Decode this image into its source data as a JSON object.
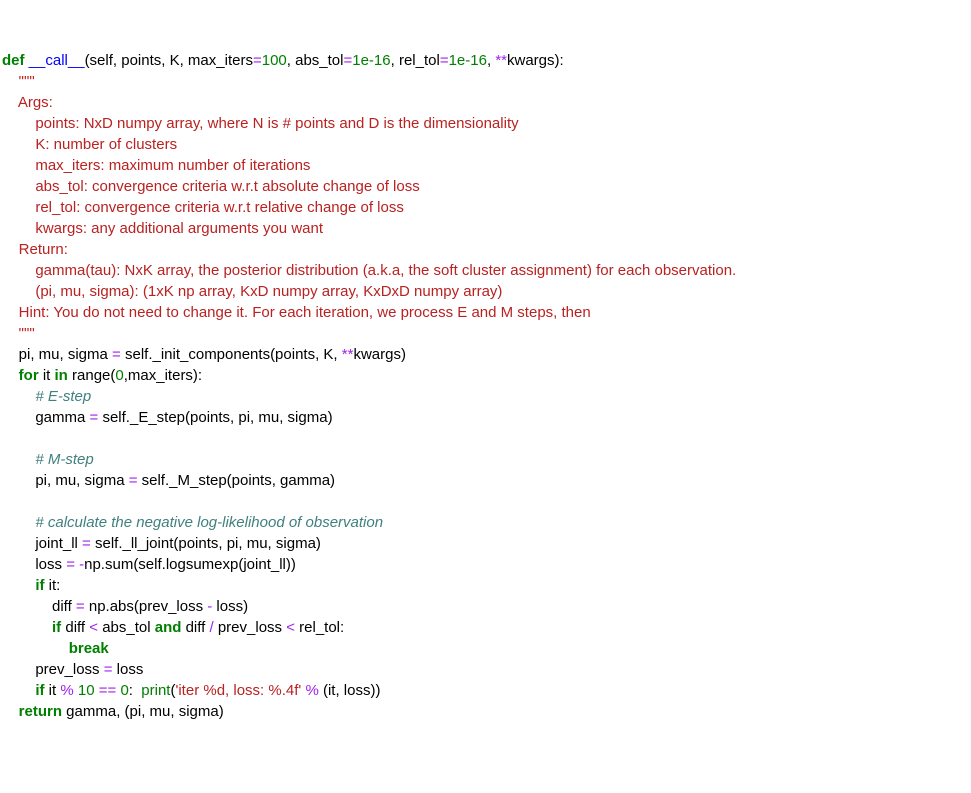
{
  "sig": {
    "def": "def",
    "name": "__call__",
    "open": "(self, points, K, max_iters",
    "eq1": "=",
    "v1": "100",
    "s1": ", abs_tol",
    "eq2": "=",
    "v2": "1e-16",
    "s2": ", rel_tol",
    "eq3": "=",
    "v3": "1e-16",
    "s3": ", ",
    "star": "**",
    "s4": "kwargs):"
  },
  "doc": {
    "q1": "    \"\"\"",
    "args": "    Args:",
    "a1": "        points: NxD numpy array, where N is # points and D is the dimensionality",
    "a2": "        K: number of clusters",
    "a3": "        max_iters: maximum number of iterations",
    "a4": "        abs_tol: convergence criteria w.r.t absolute change of loss",
    "a5": "        rel_tol: convergence criteria w.r.t relative change of loss",
    "a6": "        kwargs: any additional arguments you want",
    "ret": "    Return:",
    "r1": "        gamma(tau): NxK array, the posterior distribution (a.k.a, the soft cluster assignment) for each observation.",
    "r2": "        (pi, mu, sigma): (1xK np array, KxD numpy array, KxDxD numpy array)",
    "hint": "    Hint: You do not need to change it. For each iteration, we process E and M steps, then ",
    "q2": "    \"\"\""
  },
  "l1": {
    "pre": "    pi, mu, sigma ",
    "eq": "=",
    "mid": " self._init_components(points, K, ",
    "star": "**",
    "rest": "kwargs)"
  },
  "l2": {
    "pad": "    ",
    "for": "for",
    "mid1": " it ",
    "in": "in",
    "sp": " ",
    "range": "range",
    "open": "(",
    "zero": "0",
    "rest": ",max_iters):"
  },
  "c1": "        # E-step",
  "l3": {
    "pre": "        gamma ",
    "eq": "=",
    "rest": " self._E_step(points, pi, mu, sigma)"
  },
  "c2": "        # M-step",
  "l4": {
    "pre": "        pi, mu, sigma ",
    "eq": "=",
    "rest": " self._M_step(points, gamma)"
  },
  "c3": "        # calculate the negative log-likelihood of observation",
  "l5": {
    "pre": "        joint_ll ",
    "eq": "=",
    "rest": " self._ll_joint(points, pi, mu, sigma)"
  },
  "l6": {
    "pre": "        loss ",
    "eq": "=",
    "sp": " ",
    "neg": "-",
    "rest": "np.sum(self.logsumexp(joint_ll))"
  },
  "l7": {
    "pad": "        ",
    "if": "if",
    "rest": " it:"
  },
  "l8": {
    "pre": "            diff ",
    "eq": "=",
    "mid": " np.abs(prev_loss ",
    "minus": "-",
    "rest": " loss)"
  },
  "l9": {
    "pad": "            ",
    "if": "if",
    "s1": " diff ",
    "lt1": "<",
    "s2": " abs_tol ",
    "and": "and",
    "s3": " diff ",
    "div": "/",
    "s4": " prev_loss ",
    "lt2": "<",
    "s5": " rel_tol:"
  },
  "l10": {
    "pad": "                ",
    "break": "break"
  },
  "l11": {
    "pre": "        prev_loss ",
    "eq": "=",
    "rest": " loss"
  },
  "l12": {
    "pad": "        ",
    "if": "if",
    "s1": " it ",
    "mod": "%",
    "sp1": " ",
    "ten": "10",
    "sp2": " ",
    "eqeq": "==",
    "sp3": " ",
    "zero": "0",
    "colon": ":  ",
    "print": "print",
    "open": "(",
    "str": "'iter %d, loss: %.4f'",
    "sp4": " ",
    "mod2": "%",
    "rest": " (it, loss))"
  },
  "l13": {
    "pad": "    ",
    "return": "return",
    "rest": " gamma, (pi, mu, sigma)"
  }
}
